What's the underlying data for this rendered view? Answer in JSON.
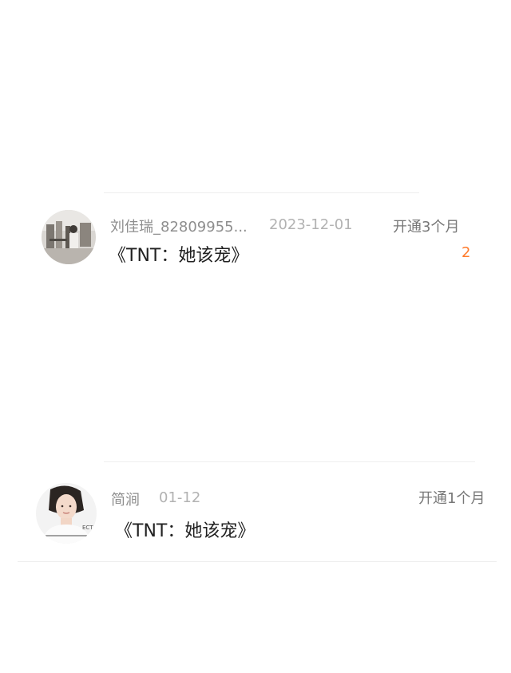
{
  "comments": [
    {
      "username": "刘佳瑞_82809955...",
      "date": "2023-12-01",
      "action": "开通3个月",
      "book": "《TNT：她该宠》",
      "mark": "2",
      "avatar": "avatar-photo-street"
    },
    {
      "username": "简涧",
      "date": "01-12",
      "action": "开通1个月",
      "book": "《TNT：她该宠》",
      "avatar": "avatar-photo-girl"
    }
  ],
  "colors": {
    "background": "#ffffff",
    "accent": "#ff7a2a",
    "text_primary": "#222222",
    "text_secondary": "#8e8e8e"
  }
}
